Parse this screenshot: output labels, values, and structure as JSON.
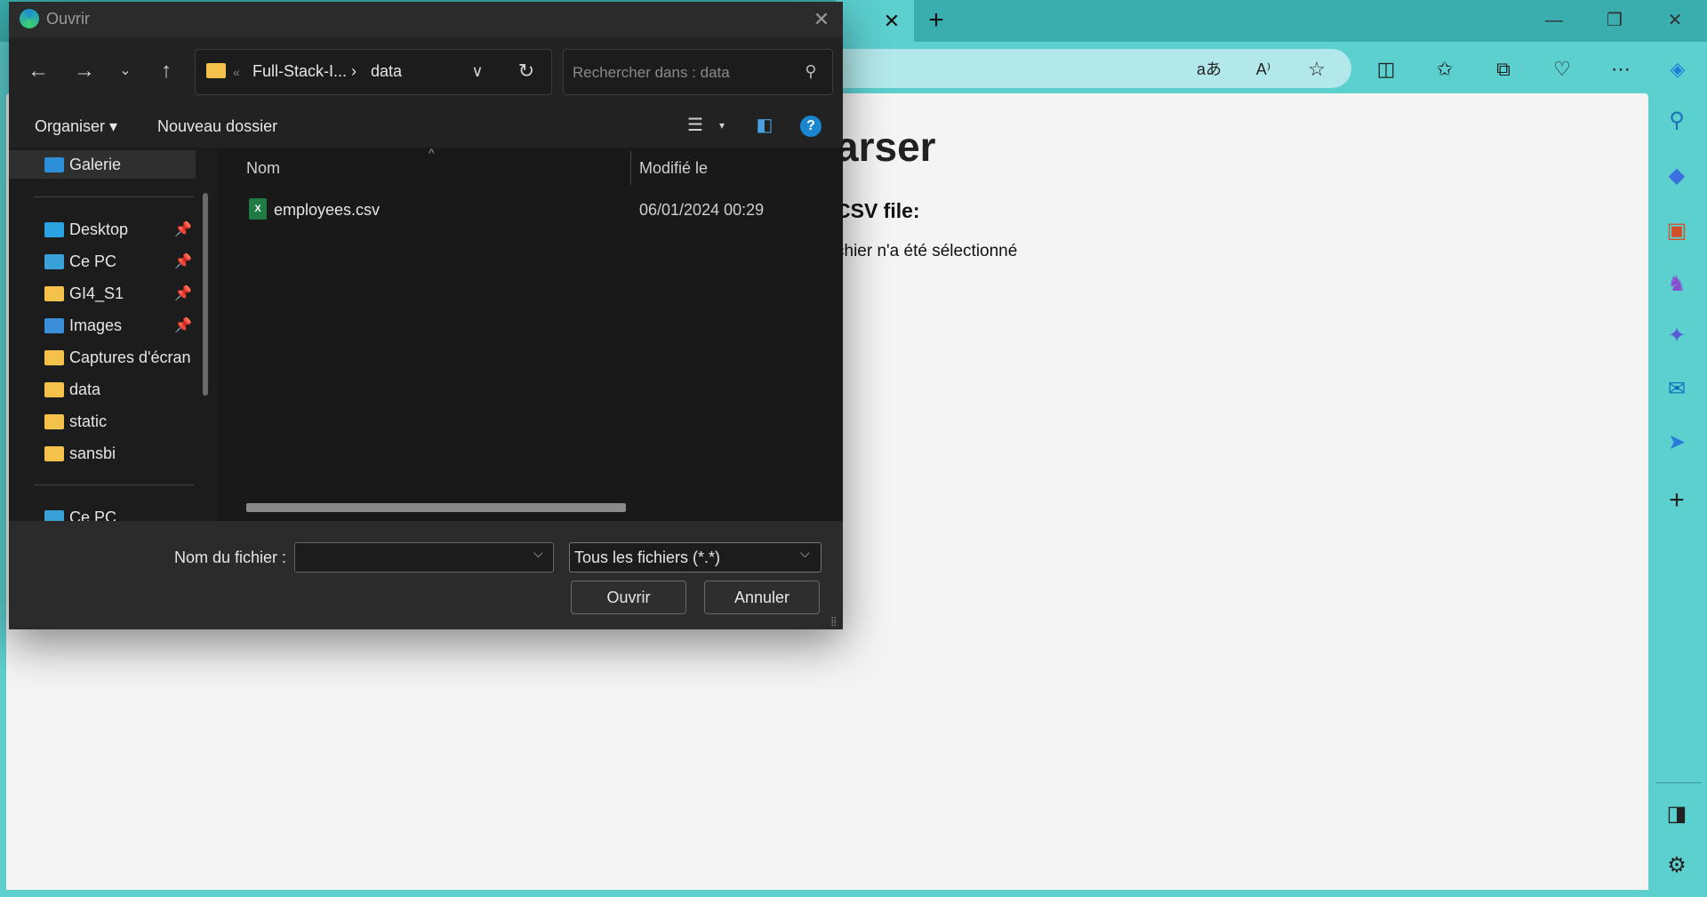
{
  "browser": {
    "tab_close": "✕",
    "new_tab": "+",
    "window_controls": {
      "minimize": "—",
      "restore": "❐",
      "close": "✕"
    },
    "toolbar_icons": [
      "translate-icon",
      "read-aloud-icon",
      "favorite-star-icon",
      "split-screen-icon",
      "favorites-icon",
      "collections-icon",
      "browser-essentials-icon",
      "more-menu-icon",
      "copilot-icon"
    ],
    "sidebar_icons": [
      "search-icon",
      "shopping-icon",
      "tools-icon",
      "games-icon",
      "copilot-icon",
      "outlook-icon",
      "send-icon",
      "add-icon",
      "sidebar-toggle-icon",
      "settings-icon"
    ]
  },
  "page": {
    "heading_fragment": "arser",
    "label_fragment": "CSV file:",
    "status_fragment": "chier n'a été sélectionné"
  },
  "dialog": {
    "title": "Ouvrir",
    "close": "✕",
    "path": {
      "ellipsis": "«",
      "folder": "Full-Stack-I...",
      "separator": "›",
      "current": "data"
    },
    "search_placeholder": "Rechercher dans : data",
    "commands": {
      "organize": "Organiser ▾",
      "new_folder": "Nouveau dossier"
    },
    "nav_items": [
      {
        "label": "Galerie",
        "icon": "gallery-icon",
        "pinned": false,
        "selected": true
      },
      {
        "label": "Desktop",
        "icon": "desktop-icon",
        "pinned": true
      },
      {
        "label": "Ce PC",
        "icon": "computer-icon",
        "pinned": true
      },
      {
        "label": "GI4_S1",
        "icon": "folder-icon",
        "pinned": true
      },
      {
        "label": "Images",
        "icon": "images-icon",
        "pinned": true
      },
      {
        "label": "Captures d'écran",
        "icon": "folder-icon",
        "pinned": false
      },
      {
        "label": "data",
        "icon": "folder-icon",
        "pinned": false
      },
      {
        "label": "static",
        "icon": "folder-icon",
        "pinned": false
      },
      {
        "label": "sansbi",
        "icon": "folder-icon",
        "pinned": false
      },
      {
        "label": "Ce PC",
        "icon": "computer-icon",
        "pinned": false
      }
    ],
    "columns": {
      "name": "Nom",
      "modified": "Modifié le"
    },
    "files": [
      {
        "name": "employees.csv",
        "modified": "06/01/2024 00:29",
        "icon": "excel-csv-icon"
      }
    ],
    "filename_label": "Nom du fichier :",
    "filename_value": "",
    "filter": "Tous les fichiers (*.*)",
    "open_button": "Ouvrir",
    "cancel_button": "Annuler"
  }
}
